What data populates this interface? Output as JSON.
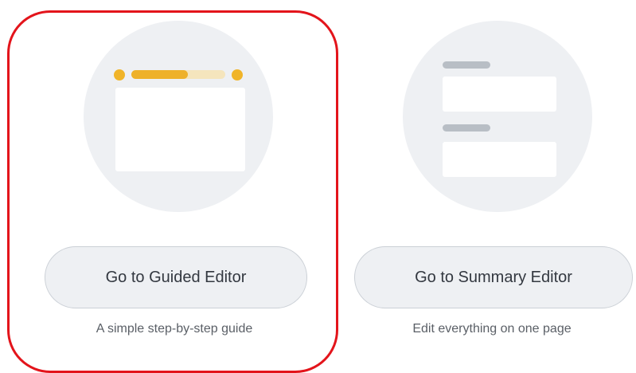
{
  "options": [
    {
      "button_label": "Go to Guided Editor",
      "caption": "A simple step-by-step guide",
      "progress_fraction": 0.6
    },
    {
      "button_label": "Go to Summary Editor",
      "caption": "Edit everything on one page"
    }
  ],
  "colors": {
    "highlight": "#e3141b",
    "progress": "#eeb12a",
    "illustration_bg": "#eef0f3"
  },
  "icons": {
    "guided": "guided-editor-illustration",
    "summary": "summary-editor-illustration"
  }
}
